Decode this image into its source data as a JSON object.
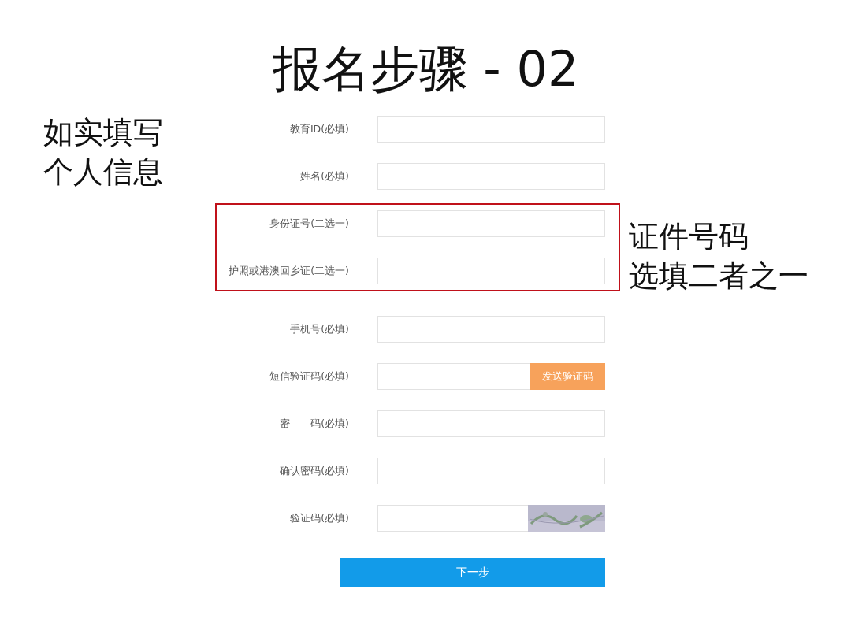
{
  "title": "报名步骤 - 02",
  "left_note": [
    "如实填写",
    "个人信息"
  ],
  "sections": [
    {
      "highlighted": false,
      "fields": [
        {
          "kind": "text",
          "label": "教育ID(必填)"
        },
        {
          "kind": "text",
          "label": "姓名(必填)"
        }
      ]
    },
    {
      "highlighted": true,
      "note": [
        "证件号码",
        "选填二者之一"
      ],
      "fields": [
        {
          "kind": "text",
          "label": "身份证号(二选一)"
        },
        {
          "kind": "text",
          "label": "护照或港澳回乡证(二选一)"
        }
      ]
    },
    {
      "highlighted": false,
      "fields": [
        {
          "kind": "text",
          "label": "手机号(必填)"
        },
        {
          "kind": "sms",
          "label": "短信验证码(必填)",
          "button": "发送验证码"
        },
        {
          "kind": "text",
          "label": "密　　码(必填)"
        },
        {
          "kind": "text",
          "label": "确认密码(必填)"
        },
        {
          "kind": "captcha",
          "label": "验证码(必填)"
        }
      ]
    }
  ],
  "submit": "下一步"
}
